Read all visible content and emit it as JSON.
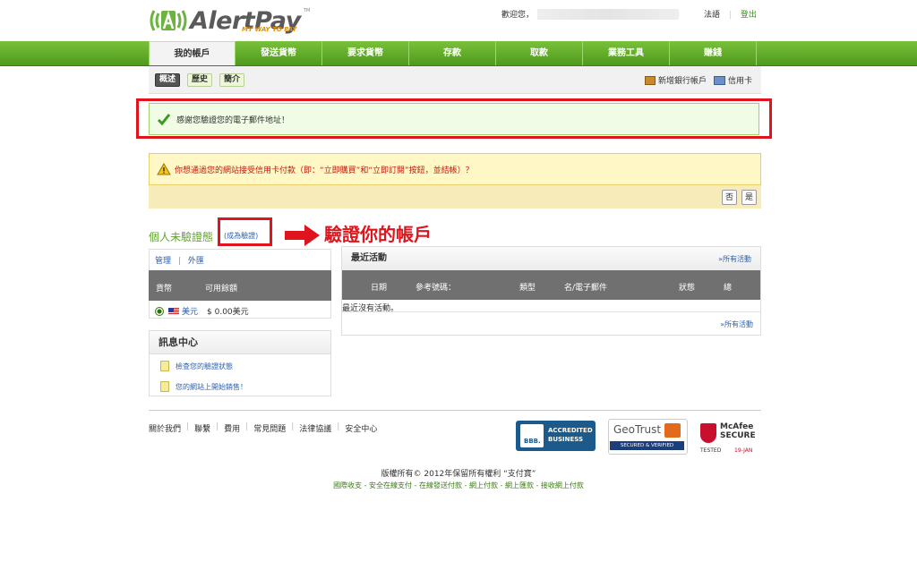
{
  "header": {
    "brand": "AlertPay",
    "tagline": "MY WAY TO PAY",
    "trademark": "TM",
    "welcome": "歡迎您，",
    "links": {
      "language": "法語",
      "logout": "登出"
    }
  },
  "nav": {
    "items": [
      "我的帳戶",
      "發送貨幣",
      "要求貨幣",
      "存款",
      "取款",
      "業務工具",
      "賺錢"
    ]
  },
  "subnav": {
    "tabs": [
      "概述",
      "歷史",
      "簡介"
    ],
    "add_bank": "新增銀行帳戶",
    "credit_card": "信用卡"
  },
  "notices": {
    "success": "感謝您驗證您的電子郵件地址！",
    "warning": "你想通過您的網站接受信用卡付款（即：“立即購買”和“立即訂閱”按鈕，並結帳）？",
    "no": "否",
    "yes": "是"
  },
  "verify": {
    "status": "個人未驗證態",
    "link": "(成為驗證)",
    "annotation": "驗證你的帳戶"
  },
  "balances": {
    "manage": "管理",
    "exchange": "外匯",
    "col_currency": "貨幣",
    "col_available": "可用餘額",
    "currency": "美元",
    "amount": "$ 0.00美元"
  },
  "messages": {
    "title": "訊息中心",
    "items": [
      "檢查您的驗證狀態",
      "您的網站上開始銷售！"
    ]
  },
  "activity": {
    "title": "最近活動",
    "all": "»所有活動",
    "columns": [
      "日期",
      "參考號碼：",
      "類型",
      "名/電子郵件",
      "狀態",
      "總"
    ],
    "empty": "最近沒有活動。"
  },
  "footer": {
    "links": [
      "關於我們",
      "聯繫",
      "費用",
      "常見問題",
      "法律協議",
      "安全中心"
    ],
    "bbb": [
      "ACCREDITED",
      "BUSINESS"
    ],
    "bbb_mark": "BBB.",
    "geotrust": "GeoTrust",
    "geotrust_sub": "SECURED & VERIFIED",
    "mcafee": [
      "McAfee",
      "SECURE"
    ],
    "mcafee_tested": "TESTED",
    "mcafee_date": "19-JAN",
    "copyright": "版權所有© 2012年保留所有權利 “支付寶”",
    "bottom_links": "國際收支 - 安全在線支付 - 在線發送付款 - 網上付款 - 網上匯款 - 接收網上付款"
  },
  "colors": {
    "brand_green": "#5fa52b",
    "alert_red": "#e0141c",
    "link_blue": "#2b5fb0"
  }
}
